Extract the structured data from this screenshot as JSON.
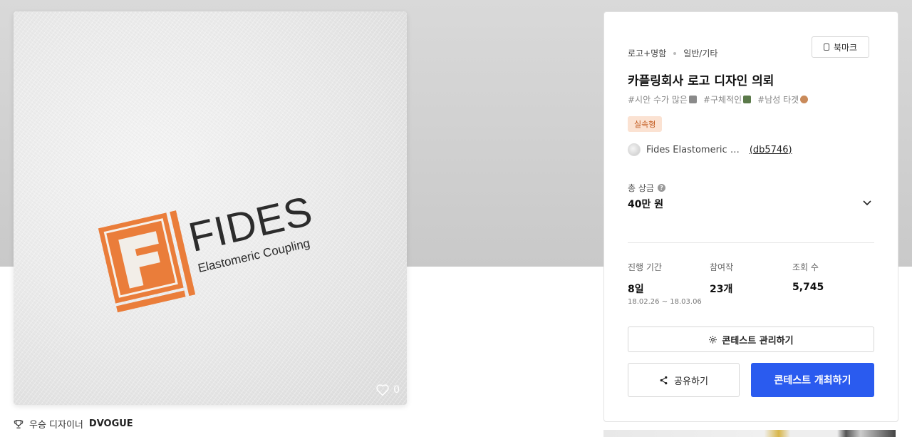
{
  "artwork": {
    "logo_word": "FIDES",
    "logo_tagline": "Elastomeric Coupling",
    "like_count": "0",
    "accent_color": "#ea7d3a"
  },
  "winner": {
    "prefix": "우승 디자이너",
    "name": "DVOGUE"
  },
  "panel": {
    "category_main": "로고+명함",
    "category_sub": "일반/기타",
    "bookmark_label": "북마크",
    "title": "카플링회사 로고 디자인 의뢰",
    "tags": [
      "#시안 수가 많은",
      "#구체적인",
      "#남성 타겟"
    ],
    "badge": "실속형",
    "client_name": "Fides Elastomeric …",
    "client_id": "(db5746)",
    "prize_label": "총 상금",
    "prize_value": "40만 원",
    "stats": [
      {
        "label": "진행 기간",
        "value": "8일",
        "sub": "18.02.26 ~ 18.03.06"
      },
      {
        "label": "참여작",
        "value": "23개",
        "sub": ""
      },
      {
        "label": "조회 수",
        "value": "5,745",
        "sub": ""
      }
    ],
    "manage_label": "콘테스트 관리하기",
    "share_label": "공유하기",
    "host_label": "콘테스트 개최하기"
  }
}
